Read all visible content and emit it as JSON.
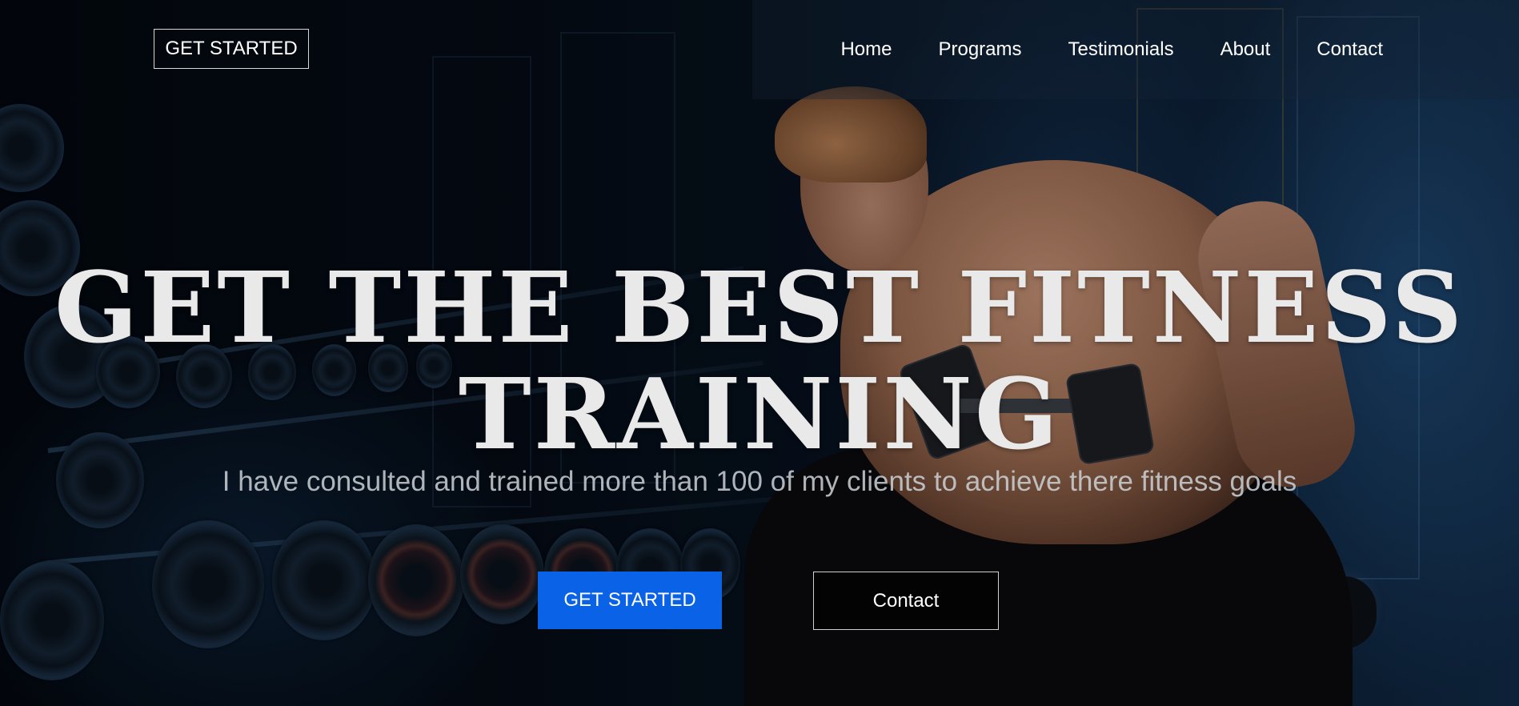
{
  "header": {
    "get_started_label": "GET STARTED",
    "nav": [
      "Home",
      "Programs",
      "Testimonials",
      "About",
      "Contact"
    ]
  },
  "hero": {
    "headline_line1": "GET THE BEST FITNESS",
    "headline_line2": "TRAINING",
    "subtitle": "I have consulted and trained more than 100 of my clients to achieve there fitness goals",
    "primary_cta": "GET STARTED",
    "secondary_cta": "Contact"
  },
  "colors": {
    "primary_button": "#0a63e6",
    "headline_text": "#e9e9e9",
    "background": "#02070d"
  }
}
